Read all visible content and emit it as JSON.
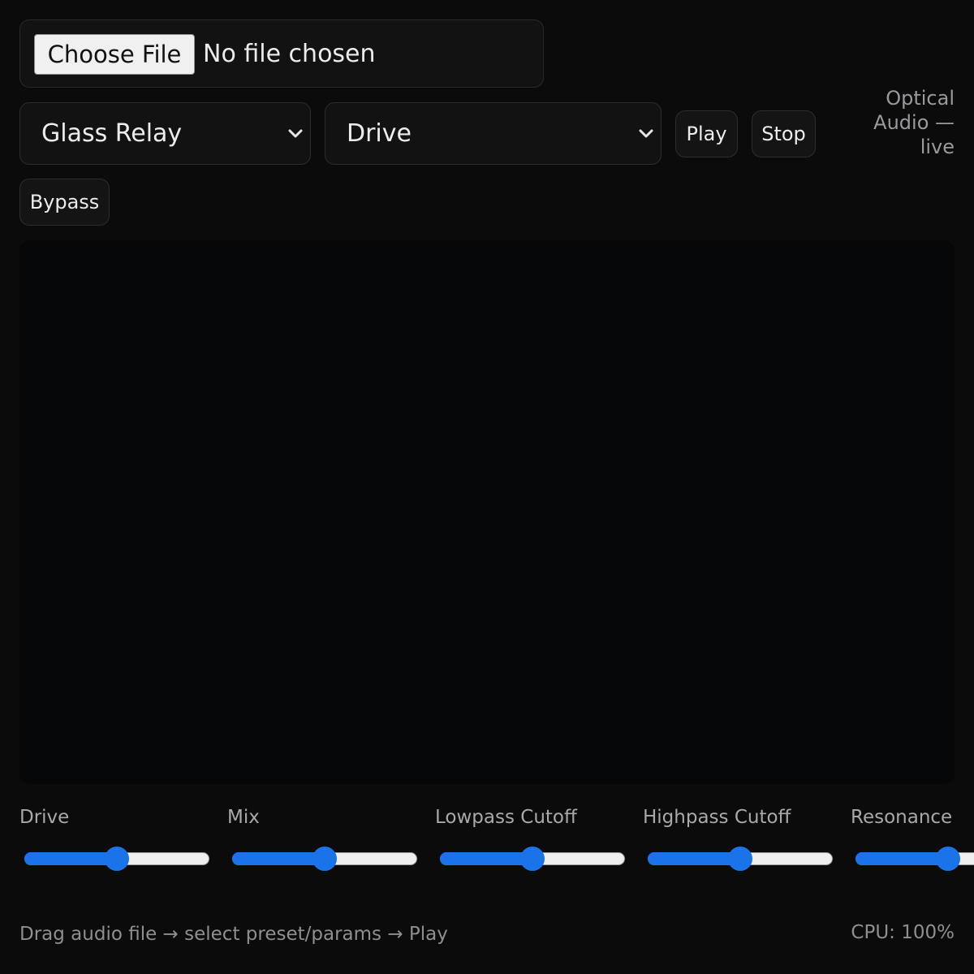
{
  "file_input": {
    "button_label": "Choose File",
    "status": "No file chosen"
  },
  "controls": {
    "preset_select": {
      "selected": "Glass Relay"
    },
    "effect_select": {
      "selected": "Drive"
    },
    "play_label": "Play",
    "stop_label": "Stop",
    "bypass_label": "Bypass"
  },
  "status_note": "Optical Audio — live",
  "sliders": [
    {
      "label": "Drive",
      "value": 0.5
    },
    {
      "label": "Mix",
      "value": 0.5
    },
    {
      "label": "Lowpass Cutoff",
      "value": 0.5
    },
    {
      "label": "Highpass Cutoff",
      "value": 0.5
    },
    {
      "label": "Resonance",
      "value": 0.5
    }
  ],
  "footer": {
    "hint": "Drag audio file → select preset/params → Play",
    "cpu": "CPU: 100%"
  },
  "colors": {
    "accent": "#1a73e8",
    "background": "#0b0b0c",
    "canvas": "#060709"
  },
  "icons": {
    "select_chevron": "chevron-down-icon"
  }
}
